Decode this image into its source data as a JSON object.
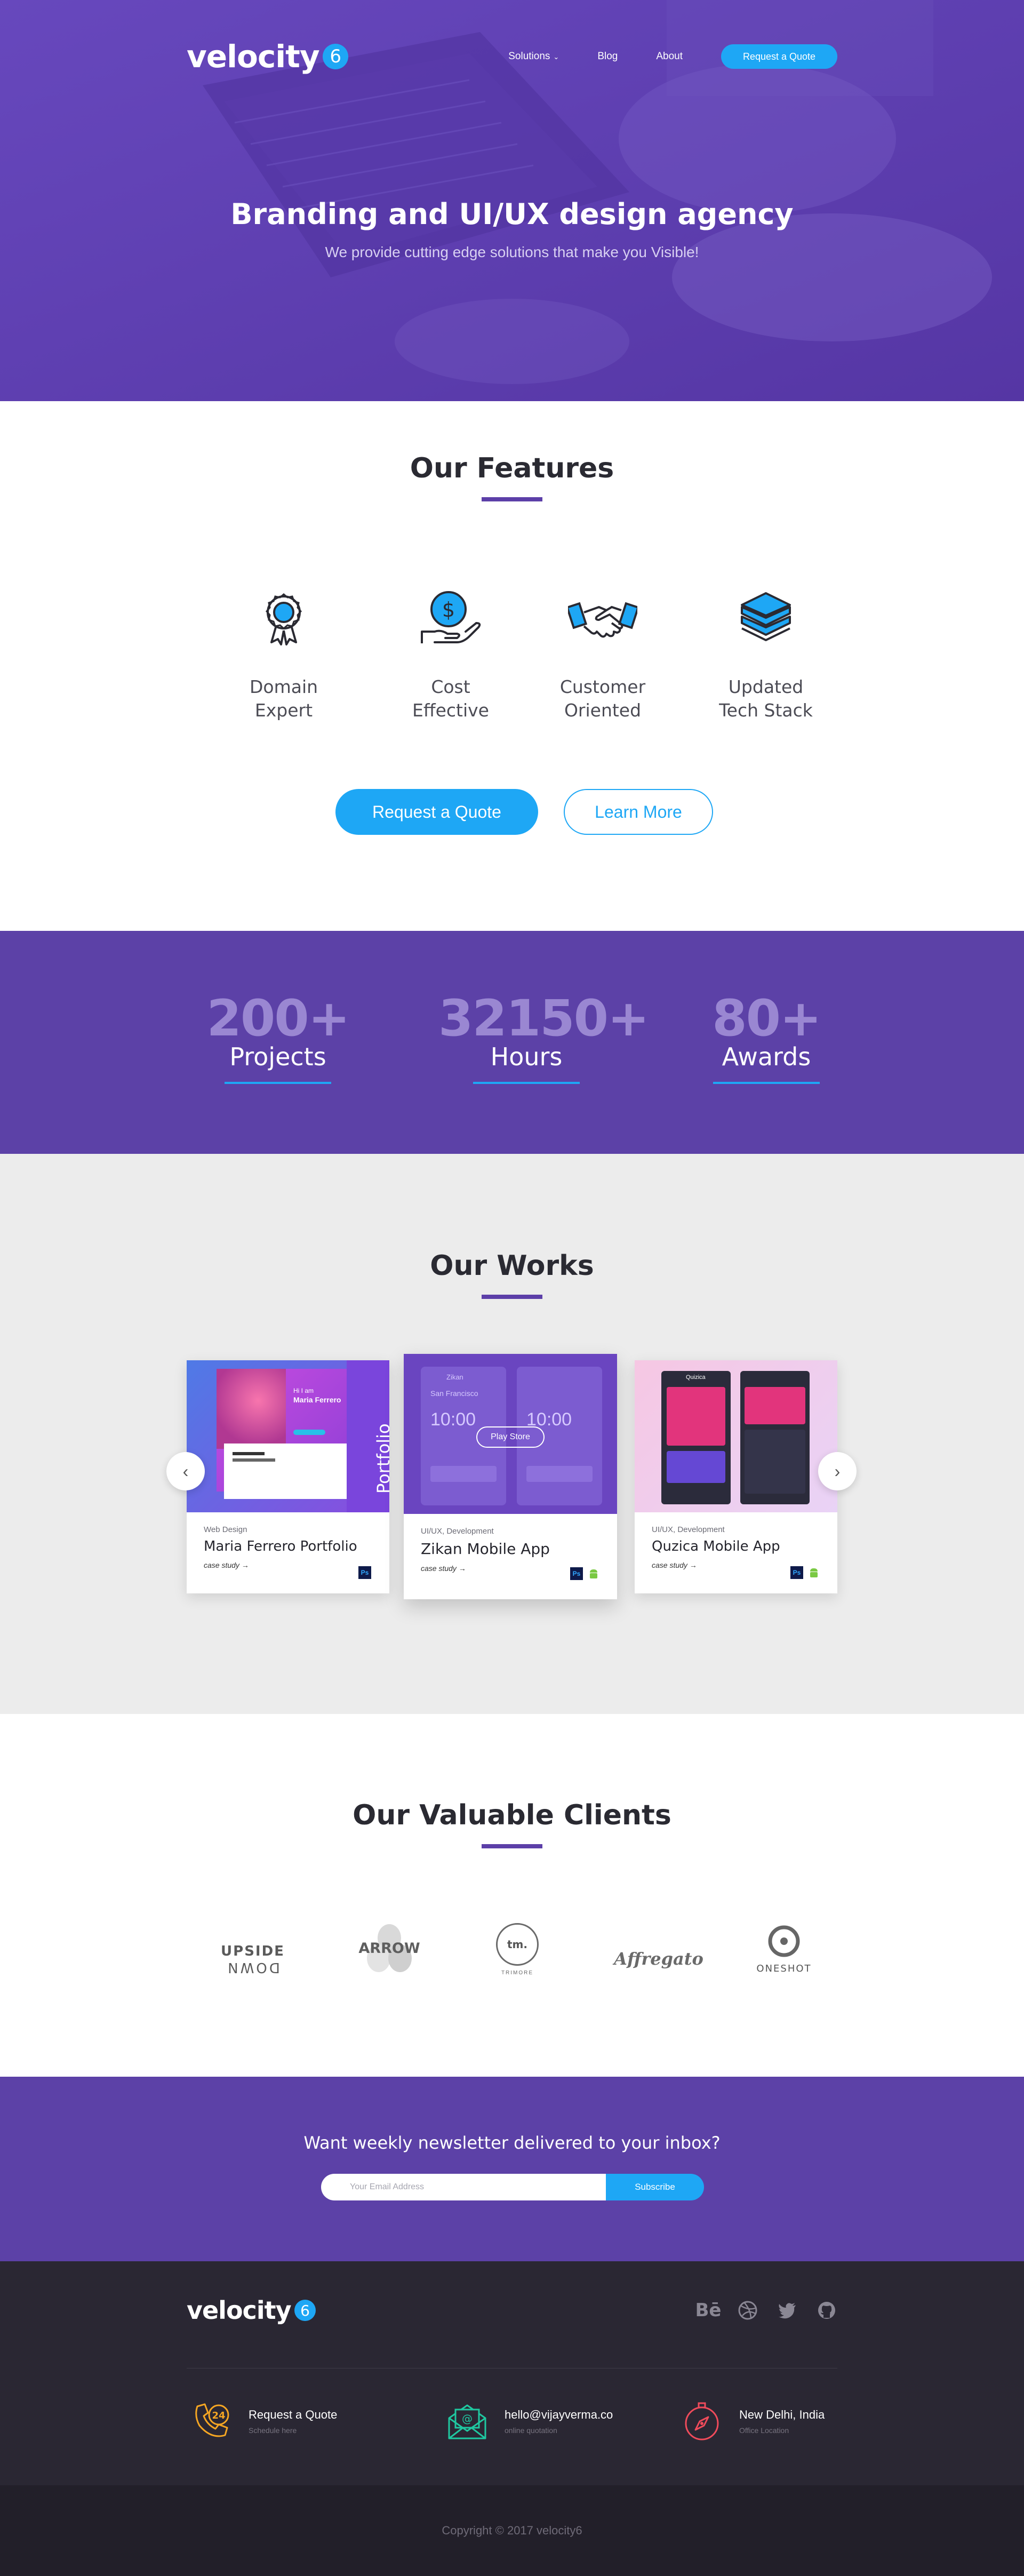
{
  "header": {
    "logo_text": "velocity",
    "logo_badge": "6",
    "nav": [
      {
        "label": "Solutions"
      },
      {
        "label": "Blog"
      },
      {
        "label": "About"
      }
    ],
    "cta": "Request a Quote"
  },
  "hero": {
    "title": "Branding and UI/UX design agency",
    "subtitle": "We provide cutting edge solutions that make you Visible!"
  },
  "features": {
    "title": "Our Features",
    "items": [
      {
        "line1": "Domain",
        "line2": "Expert",
        "icon": "award-icon"
      },
      {
        "line1": "Cost",
        "line2": "Effective",
        "icon": "money-hand-icon"
      },
      {
        "line1": "Customer",
        "line2": "Oriented",
        "icon": "handshake-icon"
      },
      {
        "line1": "Updated",
        "line2": "Tech Stack",
        "icon": "layers-icon"
      }
    ],
    "primary_cta": "Request a Quote",
    "secondary_cta": "Learn More"
  },
  "stats": [
    {
      "number": "200+",
      "label": "Projects"
    },
    {
      "number": "32150+",
      "label": "Hours"
    },
    {
      "number": "80+",
      "label": "Awards"
    }
  ],
  "works": {
    "title": "Our Works",
    "cards": [
      {
        "category": "Web Design",
        "name": "Maria Ferrero Portfolio",
        "link": "case study →",
        "overlay": "Portfolio",
        "hero_greeting": "Hi I am",
        "hero_name": "Maria Ferrero",
        "tools": [
          "Ps"
        ]
      },
      {
        "category": "UI/UX, Development",
        "name": "Zikan Mobile App",
        "link": "case study →",
        "overlay": "Play Store",
        "app_title": "Zikan",
        "city": "San Francisco",
        "time": "10:00",
        "tools": [
          "Ps",
          "android"
        ]
      },
      {
        "category": "UI/UX, Development",
        "name": "Quzica Mobile App",
        "link": "case study →",
        "app_title": "Quizica",
        "tools": [
          "Ps",
          "android"
        ]
      }
    ],
    "prev_label": "‹",
    "next_label": "›"
  },
  "clients": {
    "title": "Our Valuable Clients",
    "logos": [
      {
        "line1": "UPSIDE",
        "line2": "DOWN"
      },
      {
        "line1": "ARROW"
      },
      {
        "line1": "tm.",
        "line2": "TRIMORE"
      },
      {
        "line1": "Affregato"
      },
      {
        "line1": "ONESHOT"
      }
    ]
  },
  "newsletter": {
    "title": "Want weekly newsletter delivered to your inbox?",
    "placeholder": "Your Email Address",
    "button": "Subscribe"
  },
  "footer": {
    "logo_text": "velocity",
    "logo_badge": "6",
    "socials": [
      "behance-icon",
      "dribbble-icon",
      "twitter-icon",
      "github-icon"
    ],
    "contacts": [
      {
        "title": "Request a Quote",
        "sub": "Schedule here",
        "icon": "phone-24-icon",
        "color": "#f5a623",
        "badge": "24"
      },
      {
        "title": "hello@vijayverma.co",
        "sub": "online quotation",
        "icon": "email-icon",
        "color": "#1fc8a0"
      },
      {
        "title": "New Delhi, India",
        "sub": "Office Location",
        "icon": "compass-icon",
        "color": "#f04b5b"
      }
    ],
    "copyright": "Copyright © 2017 velocity6"
  },
  "colors": {
    "primary_purple": "#5c41a7",
    "accent_blue": "#1ea7f5",
    "footer_dark": "#2a2733"
  }
}
